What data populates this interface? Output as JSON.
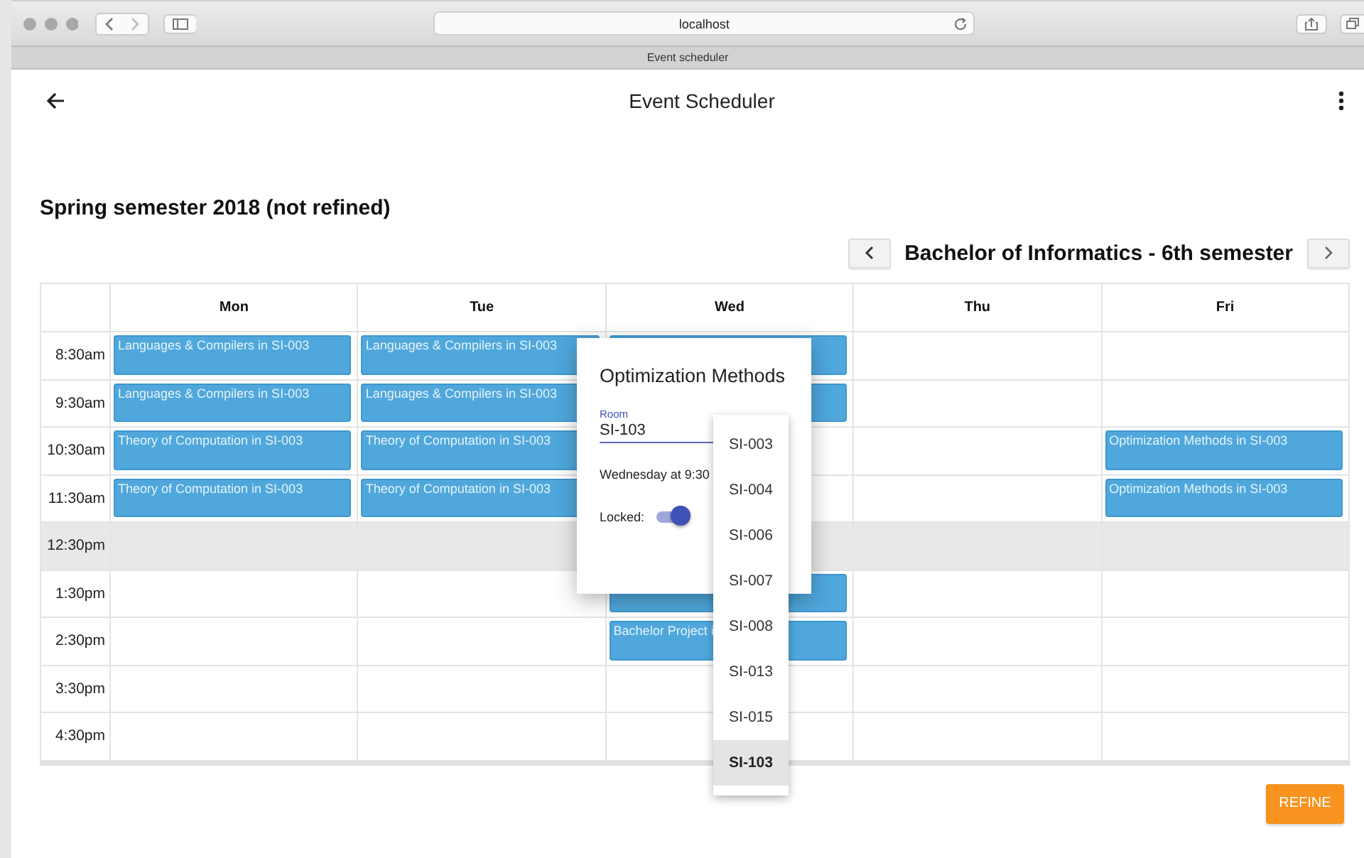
{
  "browser": {
    "url": "localhost",
    "tab_title": "Event scheduler"
  },
  "app_bar": {
    "title": "Event Scheduler"
  },
  "heading": "Spring semester 2018 (not refined)",
  "program": {
    "title": "Bachelor of Informatics - 6th semester"
  },
  "schedule": {
    "days": [
      "Mon",
      "Tue",
      "Wed",
      "Thu",
      "Fri"
    ],
    "rows": [
      {
        "time": "8:30am",
        "shaded": false,
        "cells": [
          {
            "kind": "event",
            "text": "Languages & Compilers in SI-003"
          },
          {
            "kind": "event",
            "text": "Languages & Compilers in SI-003"
          },
          {
            "kind": "event"
          },
          {
            "kind": "empty"
          },
          {
            "kind": "empty"
          }
        ]
      },
      {
        "time": "9:30am",
        "shaded": false,
        "cells": [
          {
            "kind": "event",
            "text": "Languages & Compilers in SI-003"
          },
          {
            "kind": "event",
            "text": "Languages & Compilers in SI-003"
          },
          {
            "kind": "event"
          },
          {
            "kind": "empty"
          },
          {
            "kind": "empty"
          }
        ]
      },
      {
        "time": "10:30am",
        "shaded": false,
        "cells": [
          {
            "kind": "event",
            "text": "Theory of Computation in SI-003"
          },
          {
            "kind": "event",
            "text": "Theory of Computation in SI-003"
          },
          {
            "kind": "empty"
          },
          {
            "kind": "empty"
          },
          {
            "kind": "event",
            "text": "Optimization Methods in SI-003"
          }
        ]
      },
      {
        "time": "11:30am",
        "shaded": false,
        "cells": [
          {
            "kind": "event",
            "text": "Theory of Computation in SI-003"
          },
          {
            "kind": "event",
            "text": "Theory of Computation in SI-003"
          },
          {
            "kind": "empty"
          },
          {
            "kind": "empty"
          },
          {
            "kind": "event",
            "text": "Optimization Methods in SI-003"
          }
        ]
      },
      {
        "time": "12:30pm",
        "shaded": true,
        "cells": [
          {
            "kind": "empty"
          },
          {
            "kind": "empty"
          },
          {
            "kind": "empty"
          },
          {
            "kind": "empty"
          },
          {
            "kind": "empty"
          }
        ]
      },
      {
        "time": "1:30pm",
        "shaded": false,
        "cells": [
          {
            "kind": "empty"
          },
          {
            "kind": "empty"
          },
          {
            "kind": "event"
          },
          {
            "kind": "empty"
          },
          {
            "kind": "empty"
          }
        ]
      },
      {
        "time": "2:30pm",
        "shaded": false,
        "cells": [
          {
            "kind": "empty"
          },
          {
            "kind": "empty"
          },
          {
            "kind": "event",
            "text": "Bachelor Project i"
          },
          {
            "kind": "empty"
          },
          {
            "kind": "empty"
          }
        ]
      },
      {
        "time": "3:30pm",
        "shaded": false,
        "cells": [
          {
            "kind": "empty"
          },
          {
            "kind": "empty"
          },
          {
            "kind": "empty"
          },
          {
            "kind": "empty"
          },
          {
            "kind": "empty"
          }
        ]
      },
      {
        "time": "4:30pm",
        "shaded": false,
        "cells": [
          {
            "kind": "empty"
          },
          {
            "kind": "empty"
          },
          {
            "kind": "empty"
          },
          {
            "kind": "empty"
          },
          {
            "kind": "empty"
          }
        ]
      }
    ]
  },
  "popup": {
    "title": "Optimization Methods",
    "room_label": "Room",
    "room_value": "SI-103",
    "when": "Wednesday at 9:30",
    "locked_label": "Locked:",
    "locked": true
  },
  "dropdown": {
    "options": [
      {
        "label": "SI-003",
        "selected": false
      },
      {
        "label": "SI-004",
        "selected": false
      },
      {
        "label": "SI-006",
        "selected": false
      },
      {
        "label": "SI-007",
        "selected": false
      },
      {
        "label": "SI-008",
        "selected": false
      },
      {
        "label": "SI-013",
        "selected": false
      },
      {
        "label": "SI-015",
        "selected": false
      },
      {
        "label": "SI-103",
        "selected": true
      }
    ]
  },
  "refine_button": "REFINE"
}
